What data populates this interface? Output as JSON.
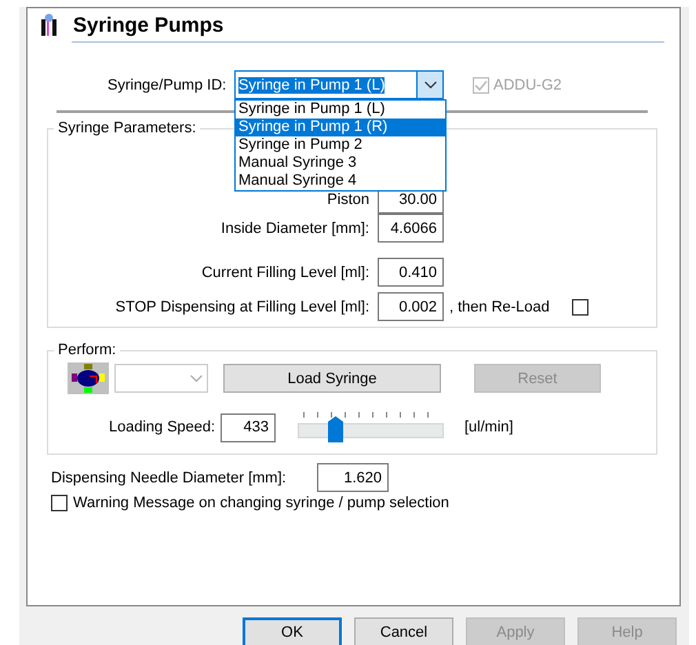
{
  "title": "Syringe Pumps",
  "pump_id": {
    "label": "Syringe/Pump ID:",
    "value": "Syringe in Pump 1 (L)",
    "expanded": true,
    "options": [
      {
        "label": "Syringe in Pump 1 (L)",
        "highlighted": false
      },
      {
        "label": "Syringe in Pump 1 (R)",
        "highlighted": true
      },
      {
        "label": "Syringe in Pump 2",
        "highlighted": false
      },
      {
        "label": "Manual Syringe 3",
        "highlighted": false
      },
      {
        "label": "Manual Syringe 4",
        "highlighted": false
      }
    ]
  },
  "addu": {
    "label": "ADDU-G2",
    "checked": true,
    "disabled": true
  },
  "syringe_parameters": {
    "title": "Syringe Parameters:",
    "fields": [
      {
        "label": "Piston",
        "value": "30.00"
      },
      {
        "label": "Inside Diameter [mm]:",
        "value": "4.6066"
      },
      {
        "label": "Current Filling Level [ml]:",
        "value": "0.410"
      },
      {
        "label": "STOP Dispensing at Filling Level [ml]:",
        "value": "0.002",
        "suffix": ", then Re-Load",
        "checked": false
      }
    ]
  },
  "perform": {
    "title": "Perform:",
    "mode_combo": {
      "disabled": true
    },
    "buttons": [
      {
        "label": "Load Syringe",
        "disabled": false
      },
      {
        "label": "Reset",
        "disabled": true
      }
    ],
    "speed": {
      "label": "Loading Speed:",
      "value": "433",
      "level": 0.25,
      "unit": "[ul/min]"
    }
  },
  "needle": {
    "label": "Dispensing Needle Diameter [mm]:",
    "value": "1.620"
  },
  "warning": {
    "label": "Warning Message on changing syringe / pump selection",
    "checked": false
  },
  "buttons": [
    {
      "label": "OK",
      "focused": true,
      "disabled": false
    },
    {
      "label": "Cancel",
      "focused": false,
      "disabled": false
    },
    {
      "label": "Apply",
      "focused": false,
      "disabled": true
    },
    {
      "label": "Help",
      "focused": false,
      "disabled": true
    }
  ]
}
